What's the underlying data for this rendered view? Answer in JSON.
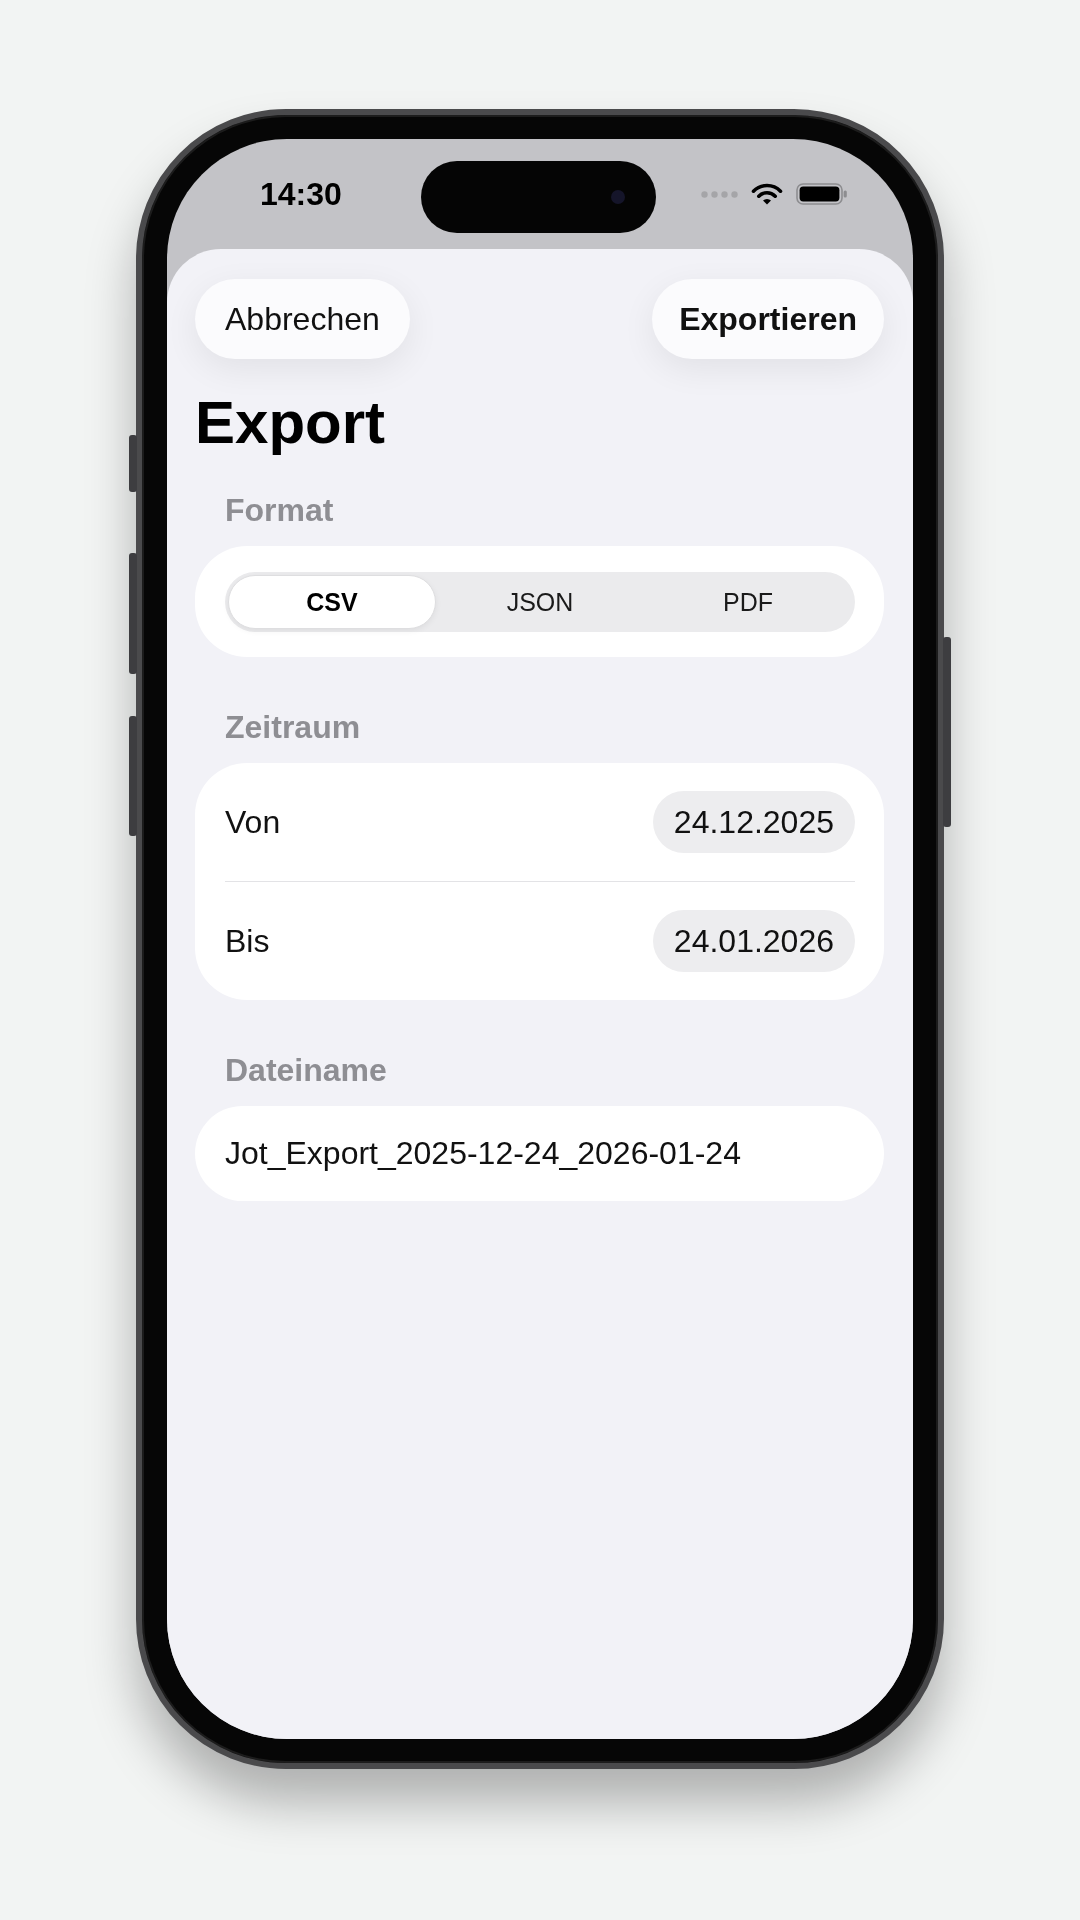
{
  "status_bar": {
    "time": "14:30"
  },
  "nav_buttons": [
    {
      "label": "Abbrechen",
      "kind": "cancel"
    },
    {
      "label": "Exportieren",
      "kind": "confirm"
    }
  ],
  "title": "Export",
  "sections": [
    {
      "kind": "segmented",
      "header": "Format",
      "options": [
        {
          "label": "CSV",
          "selected": true
        },
        {
          "label": "JSON",
          "selected": false
        },
        {
          "label": "PDF",
          "selected": false
        }
      ]
    },
    {
      "kind": "dates",
      "header": "Zeitraum",
      "rows": [
        {
          "label": "Von",
          "value": "24.12.2025"
        },
        {
          "label": "Bis",
          "value": "24.01.2026"
        }
      ]
    },
    {
      "kind": "text_field",
      "header": "Dateiname",
      "value": "Jot_Export_2025-12-24_2026-01-24"
    }
  ]
}
